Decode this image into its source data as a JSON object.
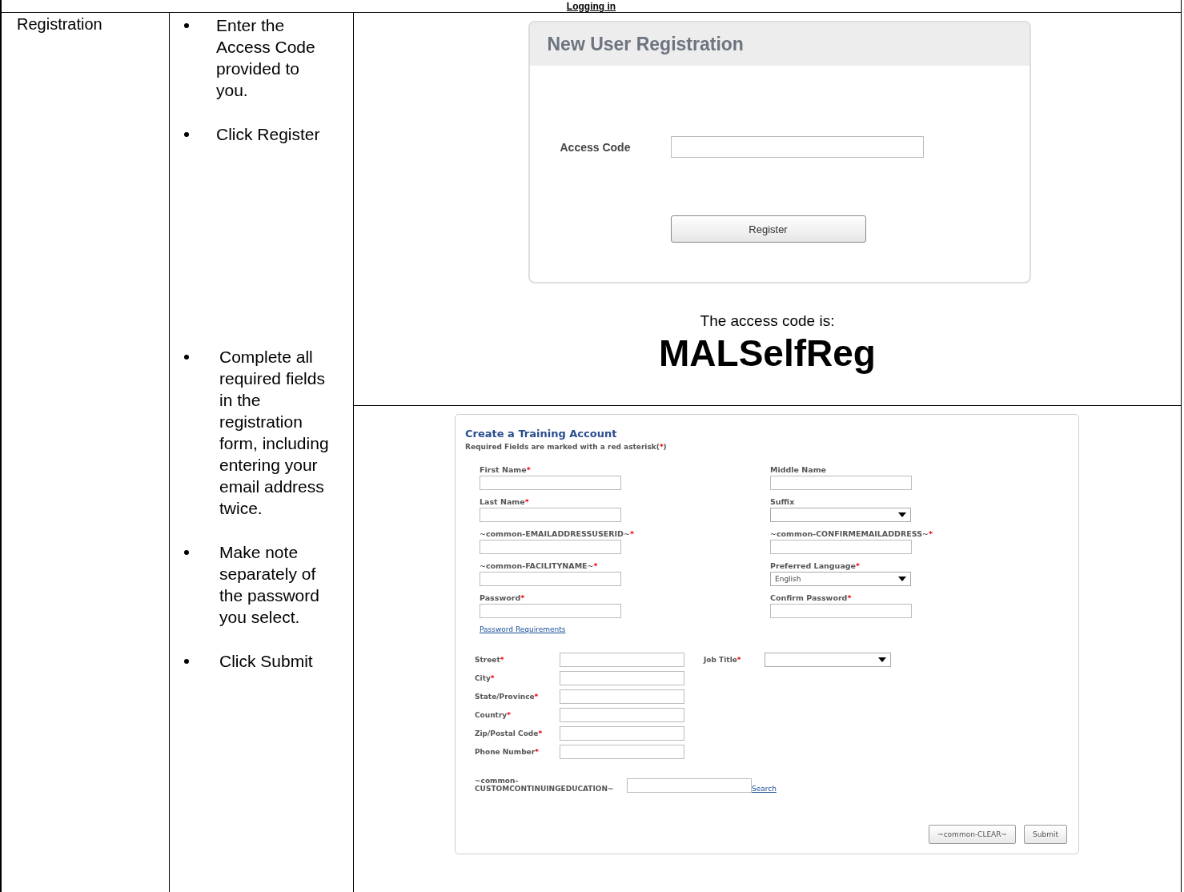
{
  "title": "Logging in",
  "row_label": "Registration",
  "steps_top": [
    {
      "text": "Enter the Access Code provided to you."
    },
    {
      "text": "Click Register"
    }
  ],
  "steps_bottom": [
    {
      "text": "Complete all required fields in the registration form, including entering your email address twice."
    },
    {
      "text": "Make note separately of the password you select."
    },
    {
      "text": "Click Submit"
    }
  ],
  "registration": {
    "title": "New User Registration",
    "field_label": "Access Code",
    "button": "Register"
  },
  "access_note": {
    "caption": "The access code is:",
    "code": "MALSelfReg"
  },
  "form": {
    "title": "Create a Training Account",
    "note_before": "Required Fields are marked with a red asterisk(",
    "note_mark": "*",
    "note_after": ")",
    "left_fields": [
      {
        "label": "First Name",
        "mark": "*",
        "kind": "text"
      },
      {
        "label": "Last Name",
        "mark": "*",
        "kind": "text"
      },
      {
        "label": "~common-EMAILADDRESSUSERID~",
        "mark": "*",
        "kind": "text"
      },
      {
        "label": "~common-FACILITYNAME~",
        "mark": "*",
        "kind": "text"
      },
      {
        "label": "Password",
        "mark": "*",
        "kind": "text"
      }
    ],
    "right_fields": [
      {
        "label": "Middle Name",
        "kind": "text"
      },
      {
        "label": "Suffix",
        "kind": "select"
      },
      {
        "label": "~common-CONFIRMEMAILADDRESS~",
        "mark": "*",
        "kind": "text"
      },
      {
        "label": "Preferred Language",
        "mark": "*",
        "kind": "select",
        "value": "English"
      },
      {
        "label": "Confirm Password",
        "mark": "*",
        "kind": "text"
      }
    ],
    "link": "Password Requirements",
    "address_fields": [
      {
        "label": "Street",
        "mark": "*"
      },
      {
        "label": "City",
        "mark": "*"
      },
      {
        "label": "State/Province",
        "mark": "*"
      },
      {
        "label": "Country",
        "mark": "*"
      },
      {
        "label": "Zip/Postal Code",
        "mark": "*"
      },
      {
        "label": "Phone Number",
        "mark": "*"
      }
    ],
    "job_title": {
      "label": "Job Title",
      "mark": "*"
    },
    "education_label": "~common-CUSTOMCONTINUINGEDUCATION~",
    "search_link": "Search",
    "buttons": [
      "~common-CLEAR~",
      "Submit"
    ]
  }
}
